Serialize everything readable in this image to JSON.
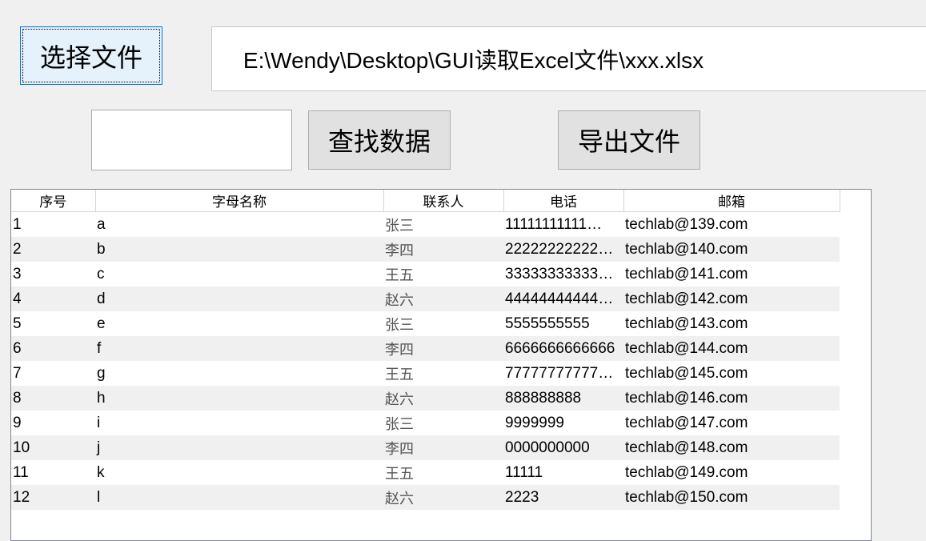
{
  "buttons": {
    "select_file": "选择文件",
    "find_data": "查找数据",
    "export_file": "导出文件"
  },
  "path": {
    "value": "E:\\Wendy\\Desktop\\GUI读取Excel文件\\xxx.xlsx"
  },
  "search": {
    "value": ""
  },
  "table": {
    "columns": [
      "序号",
      "字母名称",
      "联系人",
      "电话",
      "邮箱"
    ],
    "rows": [
      [
        "1",
        "a",
        "张三",
        "11111111111…",
        "techlab@139.com"
      ],
      [
        "2",
        "b",
        "李四",
        "22222222222…",
        "techlab@140.com"
      ],
      [
        "3",
        "c",
        "王五",
        "33333333333…",
        "techlab@141.com"
      ],
      [
        "4",
        "d",
        "赵六",
        "44444444444…",
        "techlab@142.com"
      ],
      [
        "5",
        "e",
        "张三",
        "5555555555",
        "techlab@143.com"
      ],
      [
        "6",
        "f",
        "李四",
        "6666666666666",
        "techlab@144.com"
      ],
      [
        "7",
        "g",
        "王五",
        "77777777777…",
        "techlab@145.com"
      ],
      [
        "8",
        "h",
        "赵六",
        "888888888",
        "techlab@146.com"
      ],
      [
        "9",
        "i",
        "张三",
        "9999999",
        "techlab@147.com"
      ],
      [
        "10",
        "j",
        "李四",
        "0000000000",
        "techlab@148.com"
      ],
      [
        "11",
        "k",
        "王五",
        "11111",
        "techlab@149.com"
      ],
      [
        "12",
        "l",
        "赵六",
        "2223",
        "techlab@150.com"
      ]
    ]
  }
}
